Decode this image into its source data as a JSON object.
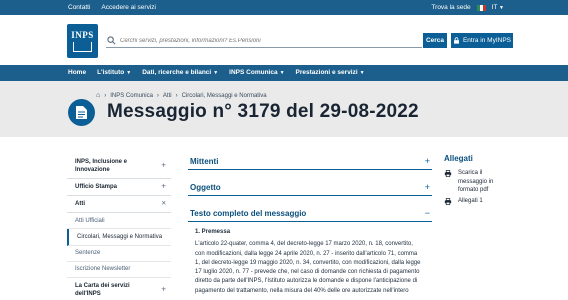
{
  "topbar": {
    "links": [
      "Contatti",
      "Accedere ai servizi"
    ],
    "location_label": "Trova la sede",
    "language": "IT"
  },
  "header": {
    "logo_text": "INPS",
    "search_placeholder": "Cerchi servizi, prestazioni, informazioni? Es.Pensioni",
    "search_button": "Cerca",
    "myinps_button": "Entra in MyINPS"
  },
  "nav": {
    "items": [
      "Home",
      "L'istituto",
      "Dati, ricerche e bilanci",
      "INPS Comunica",
      "Prestazioni e servizi"
    ]
  },
  "breadcrumb": {
    "items": [
      "INPS Comunica",
      "Atti",
      "Circolari, Messaggi e Normativa"
    ]
  },
  "page_title": "Messaggio n° 3179 del 29-08-2022",
  "sidebar": {
    "items": [
      {
        "label": "INPS, Inclusione e Innovazione",
        "toggle": "+"
      },
      {
        "label": "Ufficio Stampa",
        "toggle": "+"
      },
      {
        "label": "Atti",
        "toggle": "×"
      }
    ],
    "subitems": [
      "Atti Ufficiali",
      "Circolari, Messaggi e Normativa",
      "Sentenze",
      "Iscrizione Newsletter"
    ],
    "last_item": {
      "label": "La Carta dei servizi dell'INPS",
      "toggle": "+"
    }
  },
  "main": {
    "accordions": [
      {
        "label": "Mittenti",
        "toggle": "+"
      },
      {
        "label": "Oggetto",
        "toggle": "+"
      },
      {
        "label": "Testo completo del messaggio",
        "toggle": "−"
      }
    ],
    "section_heading": "1. Premessa",
    "body_lines": [
      "L'articolo 22-quater, comma 4, del decreto-legge 17 marzo 2020, n. 18, convertito,",
      "con modificazioni, dalla legge 24 aprile 2020, n. 27 - inserito dall'articolo 71, comma",
      "1, del decreto-legge 19 maggio 2020, n. 34, convertito, con modificazioni, dalla legge",
      "17 luglio 2020, n. 77 - prevede che, nel caso di domande con richiesta di pagamento",
      "diretto da parte dell'INPS, l'Istituto autorizza le domande e dispone l'anticipazione di",
      "pagamento del trattamento, nella misura del 40% delle ore autorizzate nell'intero"
    ]
  },
  "allegati": {
    "heading": "Allegati",
    "items": [
      "Scarica il messaggio in formato pdf",
      "Allegati 1"
    ]
  },
  "colors": {
    "primary": "#0b5f96",
    "bar": "#1d5f8c",
    "title_bg": "#eaeaea"
  }
}
